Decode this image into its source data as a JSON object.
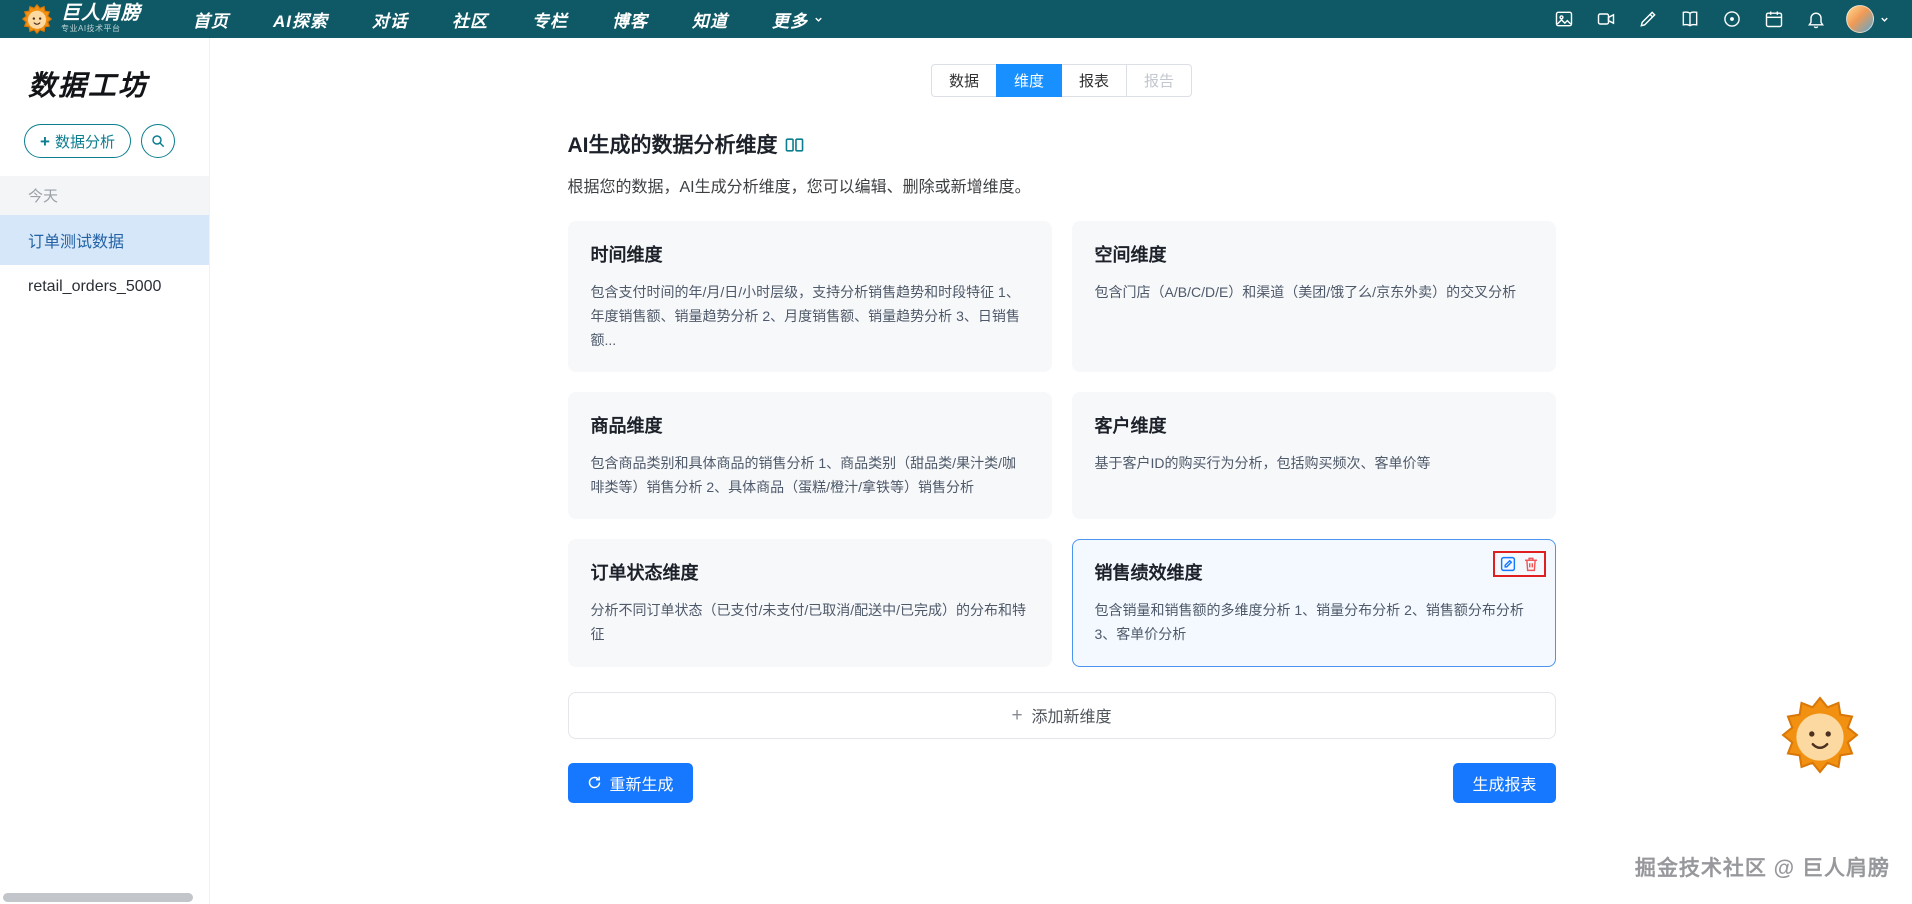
{
  "navbar": {
    "brand": "巨人肩膀",
    "tagline": "专业AI技术平台",
    "items": [
      {
        "label": "首页"
      },
      {
        "label": "AI探索"
      },
      {
        "label": "对话"
      },
      {
        "label": "社区"
      },
      {
        "label": "专栏"
      },
      {
        "label": "博客"
      },
      {
        "label": "知道"
      },
      {
        "label": "更多"
      }
    ],
    "right_icons": [
      "image-icon",
      "video-icon",
      "pen-icon",
      "book-icon",
      "target-icon",
      "calendar-icon",
      "bell-icon",
      "user-avatar"
    ]
  },
  "sidebar": {
    "title": "数据工坊",
    "new_analysis_label": "数据分析",
    "section_label": "今天",
    "items": [
      {
        "label": "订单测试数据",
        "selected": true
      },
      {
        "label": "retail_orders_5000",
        "selected": false
      }
    ]
  },
  "tabs": [
    {
      "label": "数据",
      "state": "normal"
    },
    {
      "label": "维度",
      "state": "active"
    },
    {
      "label": "报表",
      "state": "normal"
    },
    {
      "label": "报告",
      "state": "disabled"
    }
  ],
  "main": {
    "title": "AI生成的数据分析维度",
    "subtitle": "根据您的数据，AI生成分析维度，您可以编辑、删除或新增维度。",
    "cards": [
      {
        "title": "时间维度",
        "desc": "包含支付时间的年/月/日/小时层级，支持分析销售趋势和时段特征 1、年度销售额、销量趋势分析 2、月度销售额、销量趋势分析 3、日销售额...",
        "selected": false
      },
      {
        "title": "空间维度",
        "desc": "包含门店（A/B/C/D/E）和渠道（美团/饿了么/京东外卖）的交叉分析",
        "selected": false
      },
      {
        "title": "商品维度",
        "desc": "包含商品类别和具体商品的销售分析 1、商品类别（甜品类/果汁类/咖啡类等）销售分析 2、具体商品（蛋糕/橙汁/拿铁等）销售分析",
        "selected": false
      },
      {
        "title": "客户维度",
        "desc": "基于客户ID的购买行为分析，包括购买频次、客单价等",
        "selected": false
      },
      {
        "title": "订单状态维度",
        "desc": "分析不同订单状态（已支付/未支付/已取消/配送中/已完成）的分布和特征",
        "selected": false
      },
      {
        "title": "销售绩效维度",
        "desc": "包含销量和销售额的多维度分析 1、销量分布分析 2、销售额分布分析 3、客单价分析",
        "selected": true
      }
    ],
    "add_dimension_label": "添加新维度",
    "regenerate_label": "重新生成",
    "generate_report_label": "生成报表"
  },
  "watermark": "掘金技术社区 @ 巨人肩膀",
  "colors": {
    "navbar_bg": "#0e5965",
    "accent_teal": "#0c7e8f",
    "tab_active_blue": "#1890ff",
    "button_blue": "#1677ff",
    "selected_card_border": "#4b94f0",
    "selected_card_bg": "#f3f9ff",
    "card_bg": "#f7f8fa",
    "highlight_red": "#e02020",
    "delete_red": "#f25555",
    "sidebar_selected_bg": "#d5e7f8"
  }
}
